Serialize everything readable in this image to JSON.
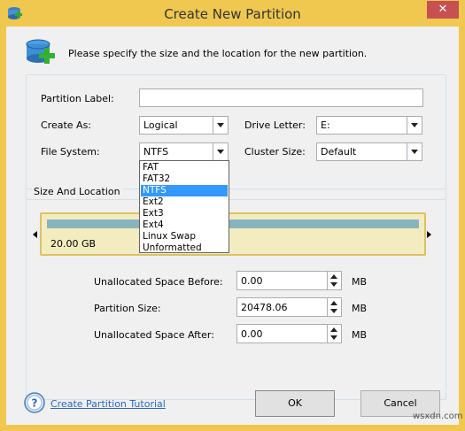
{
  "window": {
    "title": "Create New Partition",
    "close_symbol": "✕",
    "frame_color": "#f0c850"
  },
  "header": {
    "instruction": "Please specify the size and the location for the new partition."
  },
  "form": {
    "partition_label": {
      "label": "Partition Label:",
      "value": ""
    },
    "create_as": {
      "label": "Create As:",
      "value": "Logical"
    },
    "drive_letter": {
      "label": "Drive Letter:",
      "value": "E:"
    },
    "file_system": {
      "label": "File System:",
      "value": "NTFS"
    },
    "cluster_size": {
      "label": "Cluster Size:",
      "value": "Default"
    }
  },
  "file_system_dropdown": {
    "options": [
      "FAT",
      "FAT32",
      "NTFS",
      "Ext2",
      "Ext3",
      "Ext4",
      "Linux Swap",
      "Unformatted"
    ],
    "selected": "NTFS"
  },
  "size_location": {
    "group_label": "Size And Location",
    "partition_size_text": "20.00 GB",
    "unallocated_before": {
      "label": "Unallocated Space Before:",
      "value": "0.00",
      "unit": "MB"
    },
    "partition_size": {
      "label": "Partition Size:",
      "value": "20478.06",
      "unit": "MB"
    },
    "unallocated_after": {
      "label": "Unallocated Space After:",
      "value": "0.00",
      "unit": "MB"
    }
  },
  "footer": {
    "tutorial_link": "Create Partition Tutorial",
    "ok_label": "OK",
    "cancel_label": "Cancel"
  },
  "watermark": "wsxdn.com"
}
